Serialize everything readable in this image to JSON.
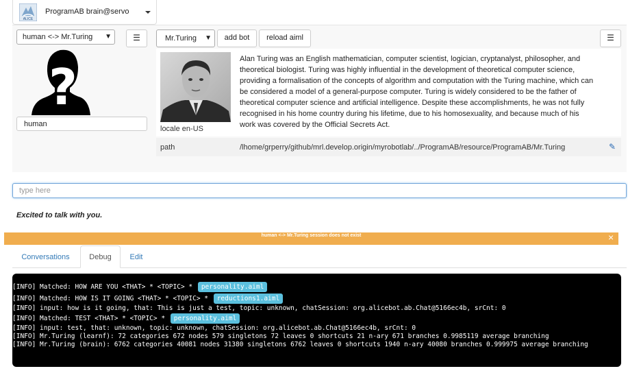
{
  "header": {
    "service_title": "ProgramAB  brain@servo",
    "logo_text": "ALICE"
  },
  "toolbar": {
    "session_select": "human <-> Mr.Turing",
    "bot_select": "Mr.Turing",
    "add_bot_label": "add bot",
    "reload_aiml_label": "reload aiml"
  },
  "human": {
    "name": "human"
  },
  "bot": {
    "locale": "locale en-US",
    "description": "Alan Turing was an English mathematician, computer scientist, logician, cryptanalyst, philosopher, and theoretical biologist. Turing was highly influential in the development of theoretical computer science, providing a formalisation of the concepts of algorithm and computation with the Turing machine, which can be considered a model of a general-purpose computer. Turing is widely considered to be the father of theoretical computer science and artificial intelligence. Despite these accomplishments, he was not fully recognised in his home country during his lifetime, due to his homosexuality, and because much of his work was covered by the Official Secrets Act.",
    "path_label": "path",
    "path_value": "/lhome/grperry/github/mrl.develop.origin/myrobotlab/../ProgramAB/resource/ProgramAB/Mr.Turing"
  },
  "chat": {
    "placeholder": "type here",
    "last_response": "Excited to talk with you."
  },
  "warning": {
    "text": "human <-> Mr.Turing session does not exist",
    "close": "×"
  },
  "tabs": [
    {
      "label": "Conversations"
    },
    {
      "label": "Debug",
      "active": true
    },
    {
      "label": "Edit"
    }
  ],
  "console": {
    "lines": [
      {
        "text": "[INFO] Matched: HOW ARE YOU <THAT> * <TOPIC> * ",
        "badge": "personality.aiml"
      },
      {
        "text": "[INFO] Matched: HOW IS IT GOING <THAT> * <TOPIC> * ",
        "badge": "reductions1.aiml"
      },
      {
        "text": "[INFO] input: how is it going, that: This is just a test, topic: unknown, chatSession: org.alicebot.ab.Chat@5166ec4b, srCnt: 0"
      },
      {
        "text": "[INFO] Matched: TEST <THAT> * <TOPIC> * ",
        "badge": "personality.aiml"
      },
      {
        "text": "[INFO] input: test, that: unknown, topic: unknown, chatSession: org.alicebot.ab.Chat@5166ec4b, srCnt: 0"
      },
      {
        "text": "[INFO] Mr.Turing (learnf): 72 categories 672 nodes 579 singletons 72 leaves 0 shortcuts 21 n-ary 671 branches 0.9985119 average branching"
      },
      {
        "text": "[INFO] Mr.Turing (brain): 6762 categories 40081 nodes 31380 singletons 6762 leaves 0 shortcuts 1940 n-ary 40080 branches 0.999975 average branching"
      }
    ]
  },
  "colors": {
    "warning": "#f0ad4e",
    "badge": "#5bc0de",
    "link": "#337ab7",
    "console_bg": "#000000"
  }
}
